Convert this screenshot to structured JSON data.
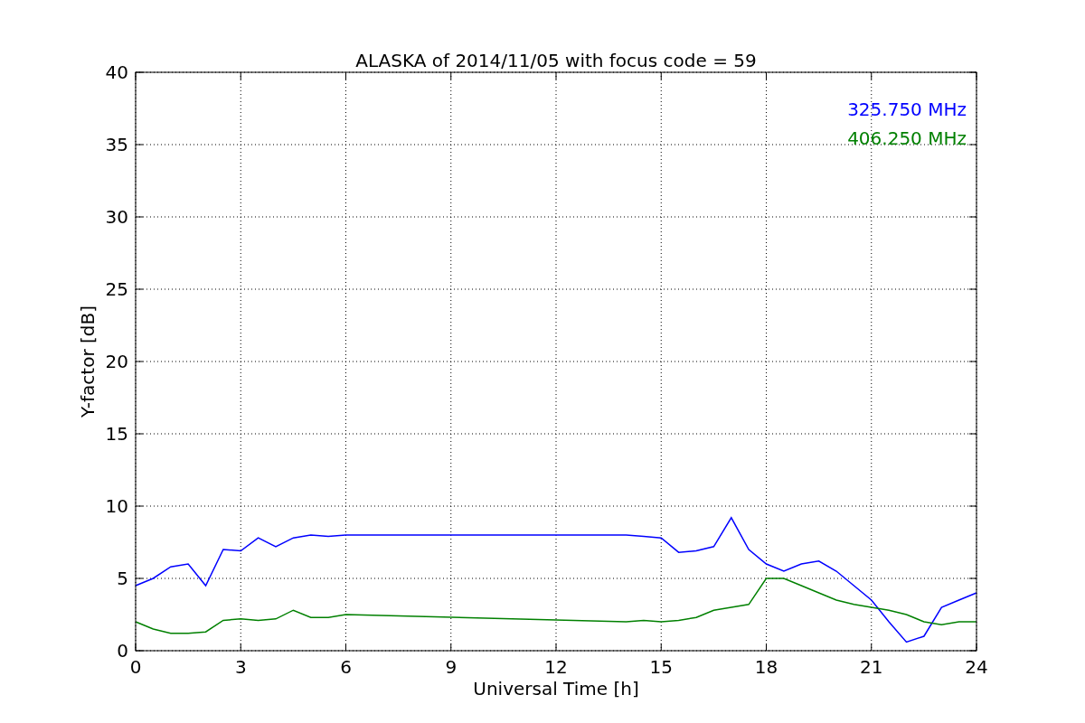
{
  "chart_data": {
    "type": "line",
    "title": "ALASKA of 2014/11/05 with focus code = 59",
    "xlabel": "Universal Time [h]",
    "ylabel": "Y-factor [dB]",
    "x": [
      0,
      0.5,
      1,
      1.5,
      2,
      2.5,
      3,
      3.5,
      4,
      4.5,
      5,
      5.5,
      6,
      14,
      14.5,
      15,
      15.5,
      16,
      16.5,
      17,
      17.5,
      18,
      18.5,
      19,
      19.5,
      20,
      20.5,
      21,
      21.5,
      22,
      22.5,
      23,
      23.5,
      24
    ],
    "series": [
      {
        "name": "325.750 MHz",
        "color": "#0000ff",
        "values": [
          4.5,
          5,
          5.8,
          6,
          4.5,
          7,
          6.9,
          7.8,
          7.2,
          7.8,
          8,
          7.9,
          8,
          8,
          7.9,
          7.8,
          6.8,
          6.9,
          7.2,
          9.2,
          7,
          6,
          5.5,
          6,
          6.2,
          5.5,
          4.5,
          3.5,
          2,
          0.6,
          1,
          3,
          3.5,
          4
        ]
      },
      {
        "name": "406.250 MHz",
        "color": "#008000",
        "values": [
          2,
          1.5,
          1.2,
          1.2,
          1.3,
          2.1,
          2.2,
          2.1,
          2.2,
          2.8,
          2.3,
          2.3,
          2.5,
          2,
          2.1,
          2,
          2.1,
          2.3,
          2.8,
          3,
          3.2,
          5,
          5,
          4.5,
          4,
          3.5,
          3.2,
          3,
          2.8,
          2.5,
          2,
          1.8,
          2,
          2
        ]
      }
    ],
    "xlim": [
      0,
      24
    ],
    "ylim": [
      0,
      40
    ],
    "xticks": [
      0,
      3,
      6,
      9,
      12,
      15,
      18,
      21,
      24
    ],
    "yticks": [
      0,
      5,
      10,
      15,
      20,
      25,
      30,
      35,
      40
    ],
    "grid": true
  }
}
